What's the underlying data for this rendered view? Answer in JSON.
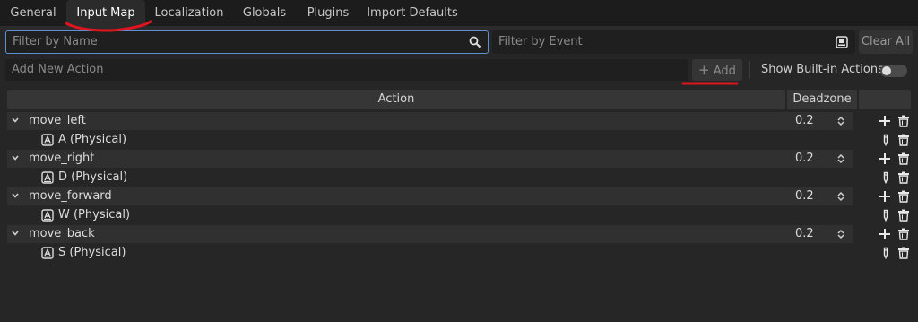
{
  "tabs": [
    {
      "label": "General"
    },
    {
      "label": "Input Map",
      "active": true
    },
    {
      "label": "Localization"
    },
    {
      "label": "Globals"
    },
    {
      "label": "Plugins"
    },
    {
      "label": "Import Defaults"
    }
  ],
  "filters": {
    "name_placeholder": "Filter by Name",
    "event_placeholder": "Filter by Event",
    "clear_all_label": "Clear All"
  },
  "add_action": {
    "placeholder": "Add New Action",
    "add_label": "Add",
    "show_builtin_label": "Show Built-in Actions",
    "show_builtin_enabled": false
  },
  "table": {
    "headers": {
      "action": "Action",
      "deadzone": "Deadzone"
    },
    "actions": [
      {
        "name": "move_left",
        "deadzone": "0.2",
        "event": "A (Physical)"
      },
      {
        "name": "move_right",
        "deadzone": "0.2",
        "event": "D (Physical)"
      },
      {
        "name": "move_forward",
        "deadzone": "0.2",
        "event": "W (Physical)"
      },
      {
        "name": "move_back",
        "deadzone": "0.2",
        "event": "S (Physical)"
      }
    ]
  },
  "colors": {
    "background": "#262626",
    "focus_border": "#5e8fd0",
    "annotation": "#e0141e"
  },
  "icons": {
    "search": "search-icon",
    "event_filter": "keyboard-icon",
    "add": "plus-icon",
    "remove": "trash-icon",
    "edit": "pencil-icon",
    "expand": "chevron-down-icon",
    "spinner": "up-down-arrows-icon",
    "key_event": "key-icon"
  }
}
